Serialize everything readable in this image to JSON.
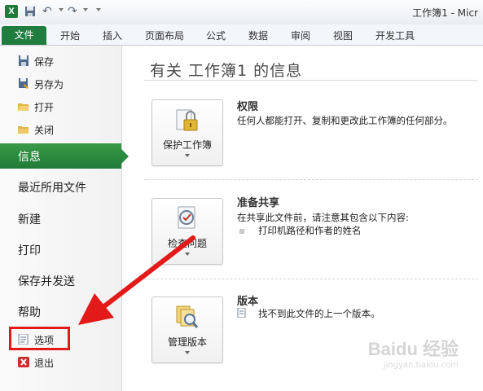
{
  "titlebar": {
    "app_icon": "X",
    "title": "工作簿1 - Micr"
  },
  "ribbon": {
    "file_tab": "文件",
    "tabs": [
      "开始",
      "插入",
      "页面布局",
      "公式",
      "数据",
      "审阅",
      "视图",
      "开发工具"
    ]
  },
  "sidebar": {
    "small_items": [
      {
        "label": "保存",
        "icon": "save-icon"
      },
      {
        "label": "另存为",
        "icon": "save-as-icon"
      },
      {
        "label": "打开",
        "icon": "open-folder-icon"
      },
      {
        "label": "关闭",
        "icon": "close-folder-icon"
      }
    ],
    "info_label": "信息",
    "big_items": [
      "最近所用文件",
      "新建",
      "打印",
      "保存并发送",
      "帮助"
    ],
    "bottom_items": [
      {
        "label": "选项",
        "icon": "options-icon"
      },
      {
        "label": "退出",
        "icon": "exit-icon"
      }
    ]
  },
  "main": {
    "title": "有关 工作簿1 的信息",
    "sections": [
      {
        "button": "保护工作簿",
        "heading": "权限",
        "desc": "任何人都能打开、复制和更改此工作簿的任何部分。"
      },
      {
        "button": "检查问题",
        "heading": "准备共享",
        "desc": "在共享此文件前，请注意其包含以下内容:",
        "bullet": "打印机路径和作者的姓名"
      },
      {
        "button": "管理版本",
        "heading": "版本",
        "desc": "找不到此文件的上一个版本。"
      }
    ]
  },
  "watermark": {
    "main": "Baidu 经验",
    "sub": "jingyan.baidu.com"
  },
  "colors": {
    "accent_green": "#217c3f",
    "highlight_red": "#e21a1a"
  }
}
